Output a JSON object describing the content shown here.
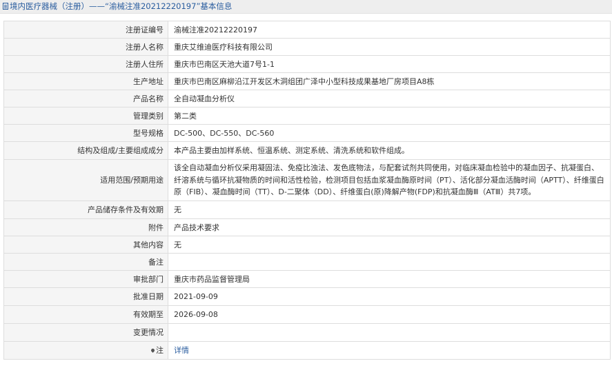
{
  "header": {
    "title": "境内医疗器械（注册）——“渝械注准20212220197”基本信息"
  },
  "rows": [
    {
      "label": "注册证编号",
      "value": "渝械注准20212220197"
    },
    {
      "label": "注册人名称",
      "value": "重庆艾维迪医疗科技有限公司"
    },
    {
      "label": "注册人住所",
      "value": "重庆市巴南区天池大道7号1-1"
    },
    {
      "label": "生产地址",
      "value": "重庆市巴南区麻柳沿江开发区木洞组团广泽中小型科技成果基地厂房项目A8栋"
    },
    {
      "label": "产品名称",
      "value": "全自动凝血分析仪"
    },
    {
      "label": "管理类别",
      "value": "第二类"
    },
    {
      "label": "型号规格",
      "value": "DC-500、DC-550、DC-560"
    },
    {
      "label": "结构及组成/主要组成成分",
      "value": "本产品主要由加样系统、恒温系统、测定系统、清洗系统和软件组成。"
    },
    {
      "label": "适用范围/预期用途",
      "value": "该全自动凝血分析仪采用凝固法、免疫比浊法、发色底物法，与配套试剂共同使用，对临床凝血检验中的凝血因子、抗凝蛋白、纤溶系统与循环抗凝物质的时间和活性检验，检测项目包括血浆凝血酶原时间（PT）、活化部分凝血活酶时间（APTT）、纤维蛋白原（FIB）、凝血酶时间（TT）、D-二聚体（DD）、纤维蛋白(原)降解产物(FDP)和抗凝血酶Ⅲ（ATⅢ）共7项。"
    },
    {
      "label": "产品储存条件及有效期",
      "value": "无"
    },
    {
      "label": "附件",
      "value": "产品技术要求"
    },
    {
      "label": "其他内容",
      "value": "无"
    },
    {
      "label": "备注",
      "value": ""
    },
    {
      "label": "审批部门",
      "value": "重庆市药品监督管理局"
    },
    {
      "label": "批准日期",
      "value": "2021-09-09"
    },
    {
      "label": "有效期至",
      "value": "2026-09-08"
    },
    {
      "label": "变更情况",
      "value": ""
    }
  ],
  "footer_row": {
    "label": "注",
    "link_text": "详情"
  }
}
